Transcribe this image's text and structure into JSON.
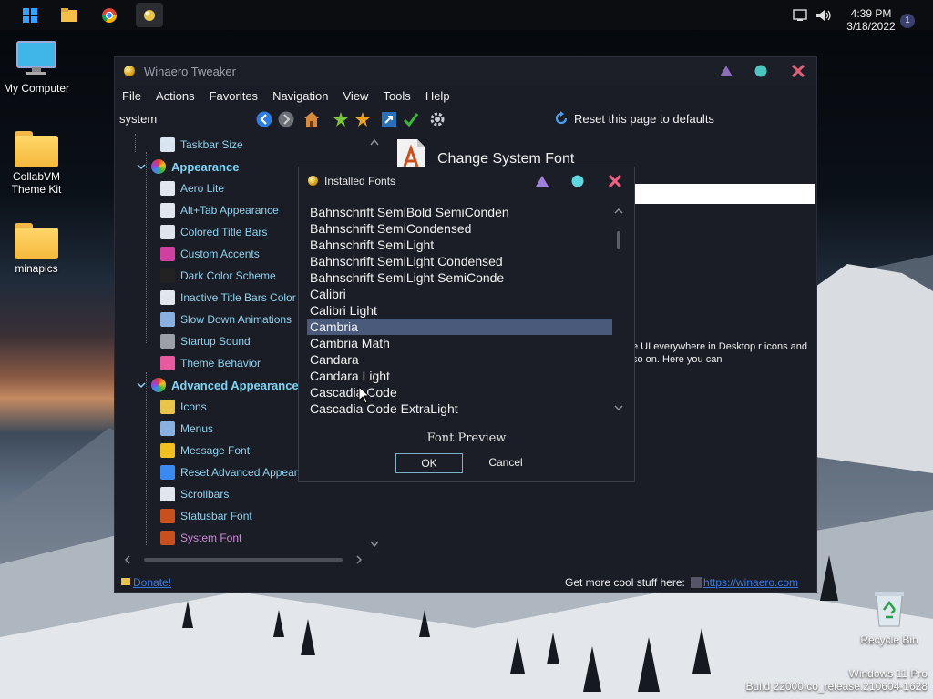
{
  "taskbar": {
    "time": "4:39 PM",
    "date": "3/18/2022",
    "notification_count": "1"
  },
  "desktop": {
    "icons": [
      {
        "label": "My Computer"
      },
      {
        "label": "CollabVM Theme Kit"
      },
      {
        "label": "minapics"
      },
      {
        "label": "Recycle Bin"
      }
    ],
    "watermark_line1": "Windows 11 Pro",
    "watermark_line2": "Build 22000.co_release.210604-1628"
  },
  "window": {
    "title": "Winaero Tweaker",
    "menu": [
      "File",
      "Actions",
      "Favorites",
      "Navigation",
      "View",
      "Tools",
      "Help"
    ],
    "search_value": "system",
    "reset_label": "Reset this page to defaults",
    "tree": [
      {
        "label": "Taskbar Size",
        "type": "item"
      },
      {
        "label": "Appearance",
        "type": "category"
      },
      {
        "label": "Aero Lite",
        "type": "item"
      },
      {
        "label": "Alt+Tab Appearance",
        "type": "item"
      },
      {
        "label": "Colored Title Bars",
        "type": "item"
      },
      {
        "label": "Custom Accents",
        "type": "item"
      },
      {
        "label": "Dark Color Scheme",
        "type": "item"
      },
      {
        "label": "Inactive Title Bars Color",
        "type": "item"
      },
      {
        "label": "Slow Down Animations",
        "type": "item"
      },
      {
        "label": "Startup Sound",
        "type": "item"
      },
      {
        "label": "Theme Behavior",
        "type": "item"
      },
      {
        "label": "Advanced Appearance Set",
        "type": "category"
      },
      {
        "label": "Icons",
        "type": "item"
      },
      {
        "label": "Menus",
        "type": "item"
      },
      {
        "label": "Message Font",
        "type": "item"
      },
      {
        "label": "Reset Advanced Appearan",
        "type": "item"
      },
      {
        "label": "Scrollbars",
        "type": "item"
      },
      {
        "label": "Statusbar Font",
        "type": "item"
      },
      {
        "label": "System Font",
        "type": "selected"
      }
    ],
    "page_title": "Change System Font",
    "description": "e UI everywhere in Desktop r icons and so on. Here you can",
    "status_left": "Donate!",
    "status_right": "Get more cool stuff here:",
    "status_link": "https://winaero.com"
  },
  "dialog": {
    "title": "Installed Fonts",
    "fonts": [
      "Bahnschrift SemiBold SemiConden",
      "Bahnschrift SemiCondensed",
      "Bahnschrift SemiLight",
      "Bahnschrift SemiLight Condensed",
      "Bahnschrift SemiLight SemiConde",
      "Calibri",
      "Calibri Light",
      "Cambria",
      "Cambria Math",
      "Candara",
      "Candara Light",
      "Cascadia Code",
      "Cascadia Code ExtraLight"
    ],
    "selected_font": "Cambria",
    "preview_label": "Font Preview",
    "ok_label": "OK",
    "cancel_label": "Cancel"
  },
  "colors": {
    "accent": "#7ed3f5",
    "selected_tree": "#d08ad8",
    "selection_bg": "#4a5a7a",
    "close": "#e0607a",
    "maximize": "#4cc4c0",
    "minimize": "#8a6fb8"
  }
}
